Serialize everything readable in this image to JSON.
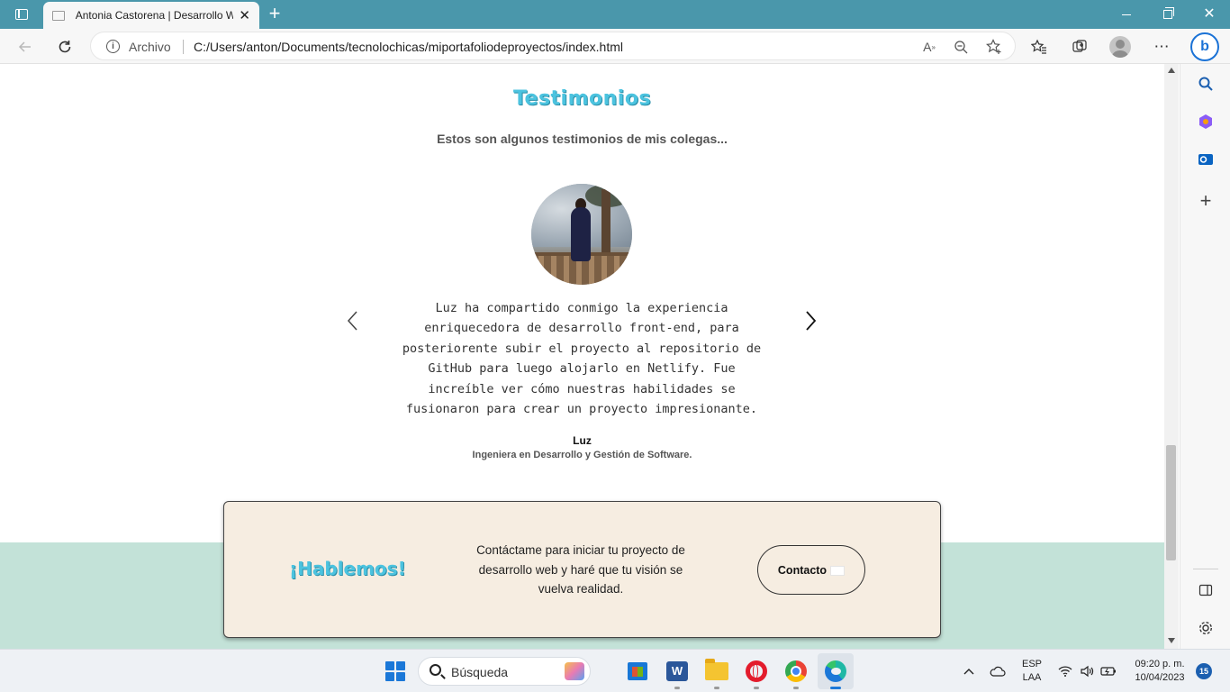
{
  "browser": {
    "tab_title": "Antonia Castorena | Desarrollo W",
    "address_prefix": "Archivo",
    "url": "C:/Users/anton/Documents/tecnolochicas/miportafoliodeproyectos/index.html"
  },
  "page": {
    "testimonials": {
      "title": "Testimonios",
      "subtitle": "Estos son algunos testimonios de mis colegas...",
      "quote": "Luz ha compartido conmigo la experiencia enriquecedora de desarrollo front-end, para posteriorente subir el proyecto al repositorio de GitHub para luego alojarlo en Netlify. Fue increíble ver cómo nuestras habilidades se fusionaron para crear un proyecto impresionante.",
      "author": "Luz",
      "role": "Ingeniera en Desarrollo y Gestión de Software."
    },
    "cta": {
      "title": "¡Hablemos!",
      "text": "Contáctame para iniciar tu proyecto de desarrollo web y haré que tu visión se vuelva realidad.",
      "button": "Contacto"
    }
  },
  "colors": {
    "titlebar": "#4a97ab",
    "accent_title": "#4cc3df",
    "footer_band": "#c3e2d8",
    "cta_card": "#f6ede1"
  },
  "taskbar": {
    "search_placeholder": "Búsqueda",
    "lang_1": "ESP",
    "lang_2": "LAA",
    "time": "09:20 p. m.",
    "date": "10/04/2023",
    "notifications": "15"
  }
}
